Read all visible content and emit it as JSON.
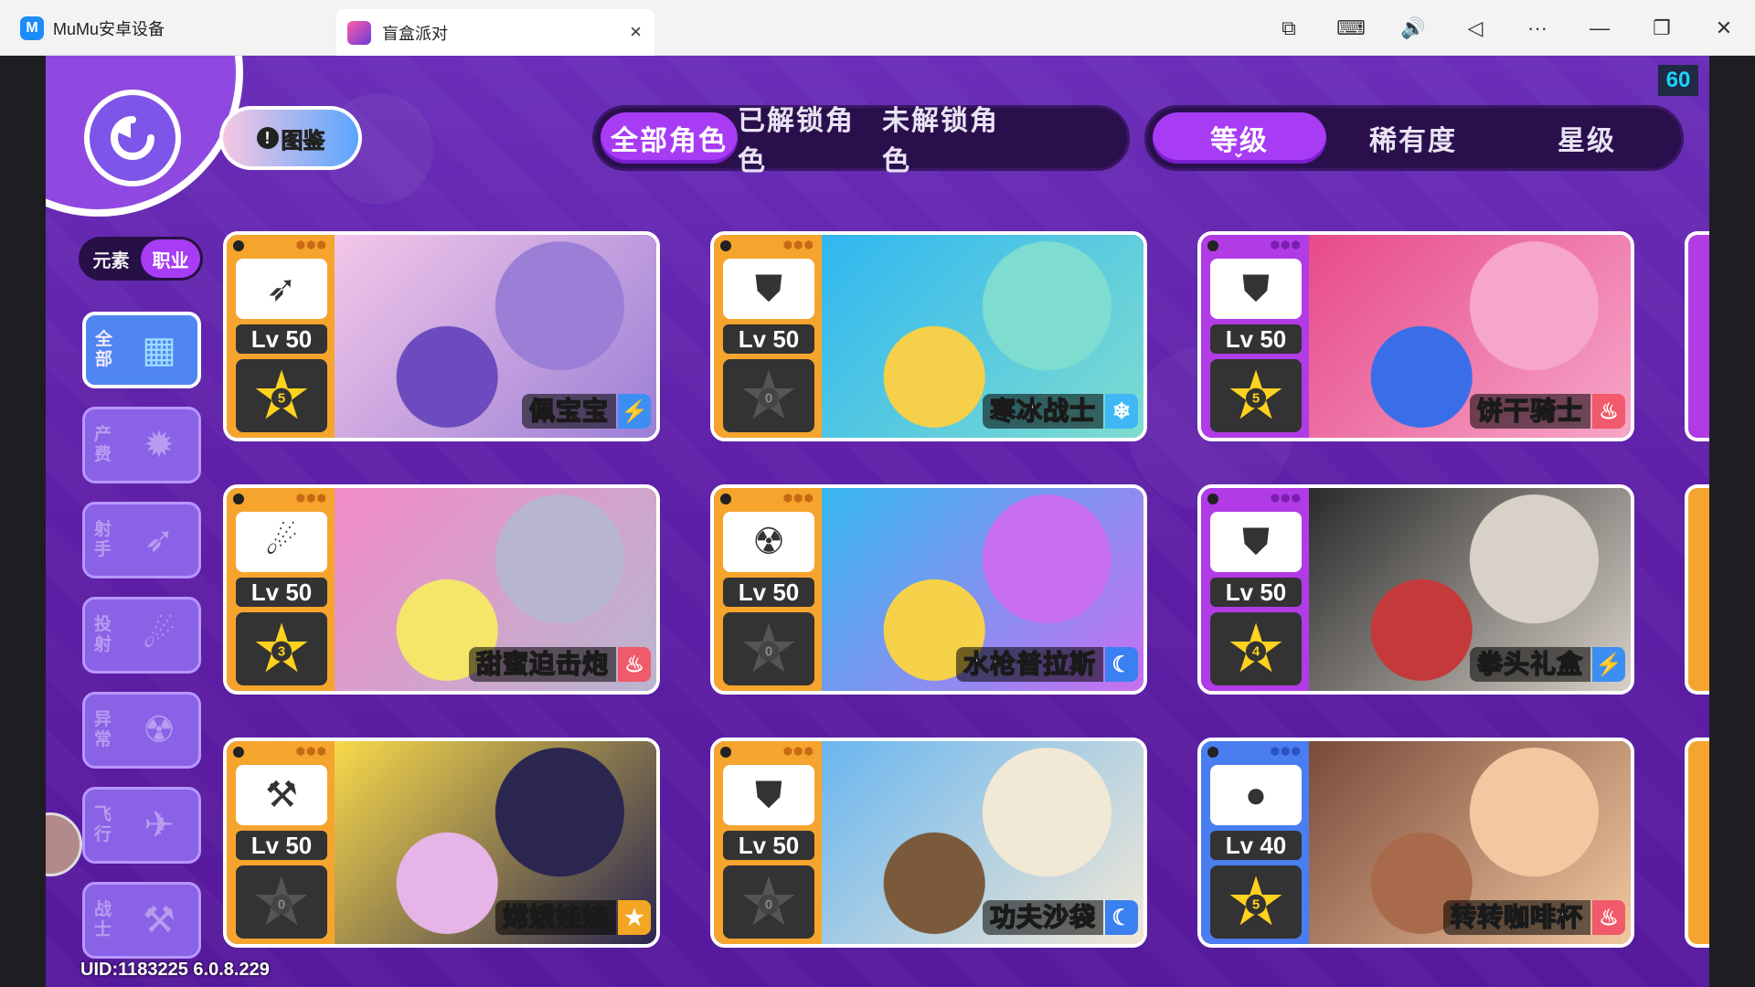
{
  "titlebar": {
    "app_name": "MuMu安卓设备",
    "app_logo": "M",
    "tab_title": "盲盒派对",
    "tab_close": "×",
    "icons": [
      {
        "name": "screen-record-icon",
        "glyph": "⧉"
      },
      {
        "name": "keyboard-icon",
        "glyph": "⌨"
      },
      {
        "name": "volume-icon",
        "glyph": "🔊"
      },
      {
        "name": "back-nav-icon",
        "glyph": "◁"
      },
      {
        "name": "more-icon",
        "glyph": "···"
      },
      {
        "name": "minimize-icon",
        "glyph": "—"
      },
      {
        "name": "restore-icon",
        "glyph": "❐"
      },
      {
        "name": "close-window-icon",
        "glyph": "✕"
      }
    ]
  },
  "game": {
    "fps": "60",
    "codex": {
      "badge": "!",
      "label": "图鉴"
    },
    "filter_tabs": [
      {
        "label": "全部角色",
        "active": true
      },
      {
        "label": "已解锁角色",
        "active": false
      },
      {
        "label": "未解锁角色",
        "active": false
      }
    ],
    "sort_tabs": [
      {
        "label": "等级",
        "active": true,
        "chevron": "⌄"
      },
      {
        "label": "稀有度",
        "active": false
      },
      {
        "label": "星级",
        "active": false
      }
    ],
    "mode_toggle": [
      {
        "label": "元素",
        "active": false
      },
      {
        "label": "职业",
        "active": true
      }
    ],
    "class_filters": [
      {
        "label": "全部",
        "icon": "all-class-icon",
        "glyph": "▦",
        "active": true
      },
      {
        "label": "产费",
        "icon": "gear-icon",
        "glyph": "✹",
        "active": false
      },
      {
        "label": "射手",
        "icon": "bow-icon",
        "glyph": "➶",
        "active": false
      },
      {
        "label": "投射",
        "icon": "cannon-icon",
        "glyph": "☄",
        "active": false
      },
      {
        "label": "异常",
        "icon": "radiation-icon",
        "glyph": "☢",
        "active": false
      },
      {
        "label": "飞行",
        "icon": "paper-plane-icon",
        "glyph": "✈",
        "active": false
      },
      {
        "label": "战士",
        "icon": "hammer-icon",
        "glyph": "⚒",
        "active": false
      }
    ],
    "uid": "UID:1183225 6.0.8.229",
    "cards": [
      {
        "name": "佩宝宝",
        "level": "Lv 50",
        "stars": "5",
        "star_active": true,
        "frame": "gold",
        "class_icon": "bow-icon",
        "class_glyph": "➶",
        "element": "lightning-icon",
        "element_glyph": "⚡",
        "element_class": "el-lightning",
        "art": [
          "#f3c7e8",
          "#9b7fd6",
          "#6b4bbd"
        ]
      },
      {
        "name": "寒冰战士",
        "level": "Lv 50",
        "stars": "0",
        "star_active": false,
        "frame": "gold",
        "class_icon": "shield-icon",
        "class_glyph": "⛊",
        "element": "snowflake-icon",
        "element_glyph": "❄",
        "element_class": "el-ice",
        "art": [
          "#2fb7f0",
          "#7fdcd0",
          "#f6d04a"
        ]
      },
      {
        "name": "饼干骑士",
        "level": "Lv 50",
        "stars": "5",
        "star_active": true,
        "frame": "purple",
        "class_icon": "shield-icon",
        "class_glyph": "⛊",
        "element": "cupcake-icon",
        "element_glyph": "♨",
        "element_class": "el-sweet",
        "art": [
          "#e74a8a",
          "#f6a6c8",
          "#3a6ee8"
        ]
      },
      {
        "name": "甜蜜迫击炮",
        "level": "Lv 50",
        "stars": "3",
        "star_active": true,
        "frame": "gold",
        "class_icon": "cannon-icon",
        "class_glyph": "☄",
        "element": "cupcake-icon",
        "element_glyph": "♨",
        "element_class": "el-sweet",
        "art": [
          "#f28bc6",
          "#b8b6cf",
          "#f5e66a"
        ]
      },
      {
        "name": "水枪普拉斯",
        "level": "Lv 50",
        "stars": "0",
        "star_active": false,
        "frame": "gold",
        "class_icon": "radiation-icon",
        "class_glyph": "☢",
        "element": "moon-icon",
        "element_glyph": "☾",
        "element_class": "el-moon",
        "art": [
          "#36b8ef",
          "#c86ff0",
          "#f6d24a"
        ]
      },
      {
        "name": "拳头礼盒",
        "level": "Lv 50",
        "stars": "4",
        "star_active": true,
        "frame": "purple",
        "class_icon": "shield-icon",
        "class_glyph": "⛊",
        "element": "lightning-icon",
        "element_glyph": "⚡",
        "element_class": "el-lightning",
        "art": [
          "#2a2a2a",
          "#d8d1c8",
          "#c43a3a"
        ]
      },
      {
        "name": "嫦娥娃娃",
        "level": "Lv 50",
        "stars": "0",
        "star_active": false,
        "frame": "gold",
        "class_icon": "hammer-icon",
        "class_glyph": "⚒",
        "element": "star-icon",
        "element_glyph": "★",
        "element_class": "el-star",
        "art": [
          "#f8d94a",
          "#2a2650",
          "#e6b4e6"
        ]
      },
      {
        "name": "功夫沙袋",
        "level": "Lv 50",
        "stars": "0",
        "star_active": false,
        "frame": "gold",
        "class_icon": "shield-icon",
        "class_glyph": "⛊",
        "element": "moon-icon",
        "element_glyph": "☾",
        "element_class": "el-moon",
        "art": [
          "#6ab6ef",
          "#f2e8d6",
          "#7a5a3a"
        ]
      },
      {
        "name": "转转咖啡杯",
        "level": "Lv 40",
        "stars": "5",
        "star_active": true,
        "frame": "blue",
        "class_icon": "bomb-icon",
        "class_glyph": "●",
        "element": "cupcake-icon",
        "element_glyph": "♨",
        "element_class": "el-sweet",
        "art": [
          "#7a4a3a",
          "#f2c8a0",
          "#a86a4a"
        ]
      }
    ],
    "peek_frames": [
      "purple",
      "gold",
      "gold"
    ]
  }
}
